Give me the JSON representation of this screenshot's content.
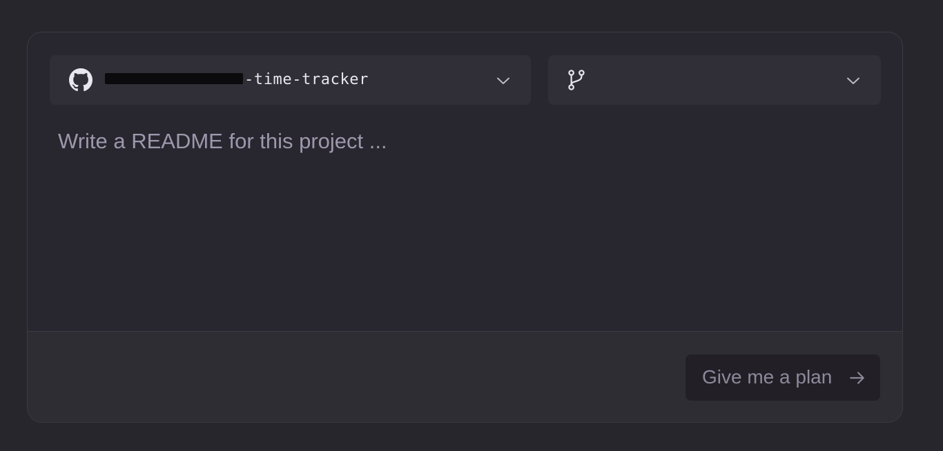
{
  "repo_select": {
    "icon": "github-icon",
    "name_visible_suffix": "-time-tracker",
    "dropdown_icon": "chevron-down-icon"
  },
  "branch_select": {
    "icon": "git-branch-icon",
    "value": "",
    "dropdown_icon": "chevron-down-icon"
  },
  "prompt": {
    "placeholder": "Write a README for this project ...",
    "value": ""
  },
  "footer": {
    "submit_label": "Give me a plan",
    "submit_icon": "arrow-right-icon"
  },
  "colors": {
    "page_bg": "#28262d",
    "card_bg": "#28262e",
    "select_bg": "#302e36",
    "footer_bg": "#2f2d34",
    "button_bg": "#221f26",
    "text_primary": "#e8e6ee",
    "placeholder": "#9d98ad",
    "button_text": "#8e899b"
  }
}
